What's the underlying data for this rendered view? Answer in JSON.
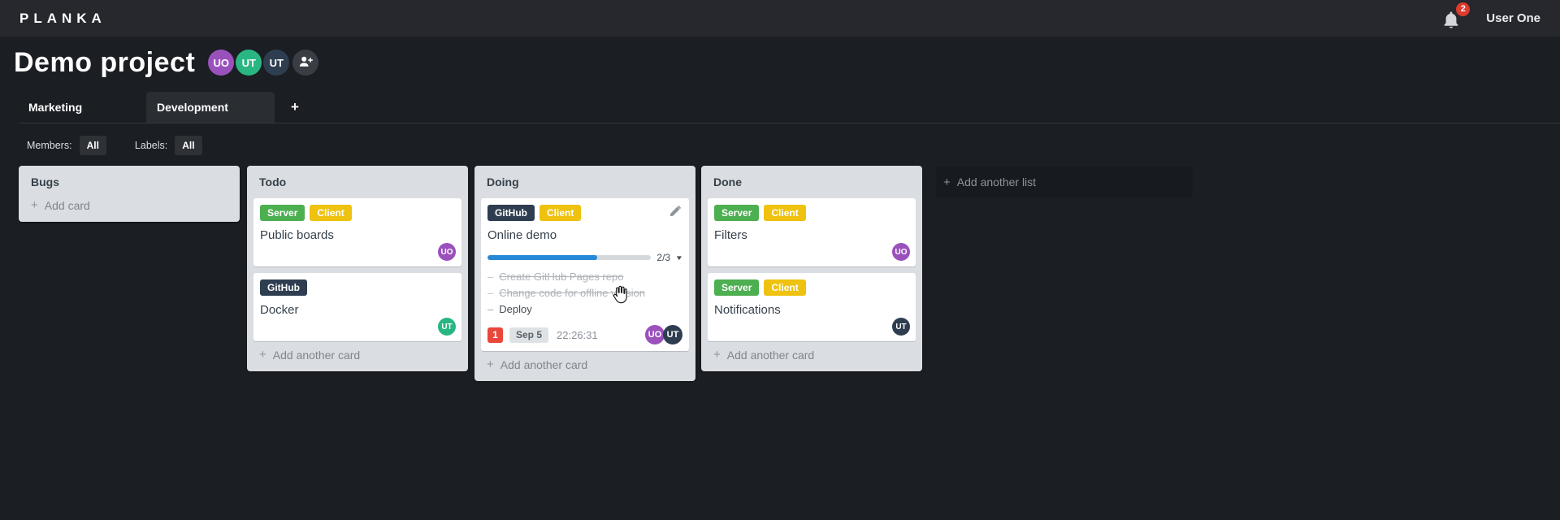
{
  "topbar": {
    "logo": "PLANKA",
    "notifications_count": "2",
    "user_name": "User One"
  },
  "project": {
    "title": "Demo project",
    "members": [
      {
        "initials": "UO",
        "color": "#9b51bc"
      },
      {
        "initials": "UT",
        "color": "#29b683"
      },
      {
        "initials": "UT",
        "color": "#2e3e50"
      }
    ]
  },
  "tabs": [
    {
      "label": "Marketing",
      "active": false
    },
    {
      "label": "Development",
      "active": true
    }
  ],
  "filters": {
    "members_label": "Members:",
    "members_value": "All",
    "labels_label": "Labels:",
    "labels_value": "All"
  },
  "board": {
    "lists": [
      {
        "title": "Bugs",
        "cards": [],
        "footer_label": "Add card"
      },
      {
        "title": "Todo",
        "cards": [
          {
            "title": "Public boards",
            "labels": [
              {
                "text": "Server",
                "color": "#4caf50"
              },
              {
                "text": "Client",
                "color": "#eec20e"
              }
            ],
            "members": [
              {
                "initials": "UO",
                "color": "#9b51bc"
              }
            ]
          },
          {
            "title": "Docker",
            "labels": [
              {
                "text": "GitHub",
                "color": "#2e3e50"
              }
            ],
            "members": [
              {
                "initials": "UT",
                "color": "#29b683"
              }
            ]
          }
        ],
        "footer_label": "Add another card"
      },
      {
        "title": "Doing",
        "cards": [
          {
            "title": "Online demo",
            "editable": true,
            "labels": [
              {
                "text": "GitHub",
                "color": "#2e3e50"
              },
              {
                "text": "Client",
                "color": "#eec20e"
              }
            ],
            "progress": {
              "label": "2/3",
              "percent": 67,
              "color": "#2589d8"
            },
            "tasks": [
              {
                "text": "Create GitHub Pages repo",
                "done": true
              },
              {
                "text": "Change code for offline version",
                "done": true
              },
              {
                "text": "Deploy",
                "done": false
              }
            ],
            "badges": {
              "notifications": "1",
              "notifications_color": "#e8473a",
              "due_date": "Sep 5",
              "timer": "22:26:31"
            },
            "members": [
              {
                "initials": "UO",
                "color": "#9b51bc"
              },
              {
                "initials": "UT",
                "color": "#2e3e50"
              }
            ]
          }
        ],
        "footer_label": "Add another card"
      },
      {
        "title": "Done",
        "cards": [
          {
            "title": "Filters",
            "labels": [
              {
                "text": "Server",
                "color": "#4caf50"
              },
              {
                "text": "Client",
                "color": "#eec20e"
              }
            ],
            "members": [
              {
                "initials": "UO",
                "color": "#9b51bc"
              }
            ]
          },
          {
            "title": "Notifications",
            "labels": [
              {
                "text": "Server",
                "color": "#4caf50"
              },
              {
                "text": "Client",
                "color": "#eec20e"
              }
            ],
            "members": [
              {
                "initials": "UT",
                "color": "#2e3e50"
              }
            ]
          }
        ],
        "footer_label": "Add another card"
      }
    ],
    "add_list_label": "Add another list"
  },
  "icons": {
    "plus": "+",
    "caret_down": "▼",
    "task_dash": "–"
  }
}
